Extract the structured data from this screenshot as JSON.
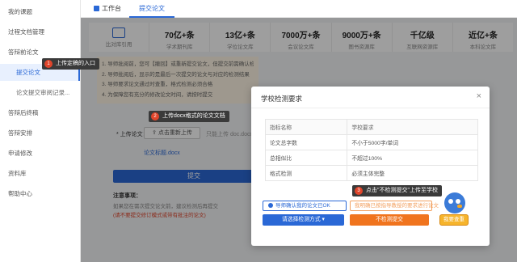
{
  "sidebar": {
    "items": [
      {
        "label": "我的课题",
        "sub": false,
        "active": false
      },
      {
        "label": "过程文档管理",
        "sub": false,
        "active": false
      },
      {
        "label": "答辩前论文",
        "sub": false,
        "active": false
      },
      {
        "label": "提交论文",
        "sub": true,
        "active": true
      },
      {
        "label": "论文提交审阅记录...",
        "sub": true,
        "active": false
      },
      {
        "label": "答辩后终稿",
        "sub": false,
        "active": false
      },
      {
        "label": "答辩安排",
        "sub": false,
        "active": false
      },
      {
        "label": "申请修改",
        "sub": false,
        "active": false
      },
      {
        "label": "资料库",
        "sub": false,
        "active": false
      },
      {
        "label": "帮助中心",
        "sub": false,
        "active": false
      }
    ]
  },
  "top_tabs": {
    "workspace": "工作台",
    "submit": "提交论文"
  },
  "stats": [
    {
      "value": "",
      "label": "比对库引用"
    },
    {
      "value": "70亿+条",
      "label": "学术期刊库"
    },
    {
      "value": "13亿+条",
      "label": "学位论文库"
    },
    {
      "value": "7000万+条",
      "label": "会议论文库"
    },
    {
      "value": "9000万+条",
      "label": "图书资源库"
    },
    {
      "value": "千亿级",
      "label": "互联网资源库"
    },
    {
      "value": "近亿+条",
      "label": "本科论文库"
    }
  ],
  "notices": [
    "1. 导师批阅前，您可【撤回】或重新提交论文，但提交前需确认检测结果",
    "2. 导师批阅后，显示的是最后一次提交的论文与对应的检测结果",
    "3. 导师要求论文通过时查重，格式检测必须合格",
    "4. 为保障您有充分的修改论文时间，请按时提交"
  ],
  "upload": {
    "label": "* 上传论文：",
    "choose_button": "点击重新上传",
    "hint": "只能上传 doc.docx格式",
    "filename": "论文标题.docx",
    "submit_button": "提交"
  },
  "notes": {
    "title": "注意事项：",
    "line1": "如果您在需次提交论文前，建议检测后再提交",
    "line2": "(请不要提交修订模式或带有批注的论文)"
  },
  "modal": {
    "title": "学校检测要求",
    "close": "×",
    "table_headers": [
      "指标名称",
      "学校要求"
    ],
    "rows": [
      [
        "论文总字数",
        "不小于5000字/单词"
      ],
      [
        "总相似比",
        "不超过100%"
      ],
      [
        "格式检测",
        "必须主体完整"
      ]
    ],
    "tip_upload": "导师确认我的论文已OK",
    "tip_guide": "我明确已按指导教授的要求进行论文",
    "btn_select": "请选择检测方式 ▾",
    "btn_nocheck": "不检测提交",
    "mascot_button": "我要查重"
  },
  "callouts": [
    {
      "num": "1",
      "text": "上传定稿的入口"
    },
    {
      "num": "2",
      "text": "上传docx格式的论文文档"
    },
    {
      "num": "3",
      "text": "点击\"不检测提交\"上传至学校"
    }
  ],
  "colors": {
    "primary": "#2a68d6",
    "orange": "#f0741e",
    "callout_badge": "#e0452b"
  }
}
